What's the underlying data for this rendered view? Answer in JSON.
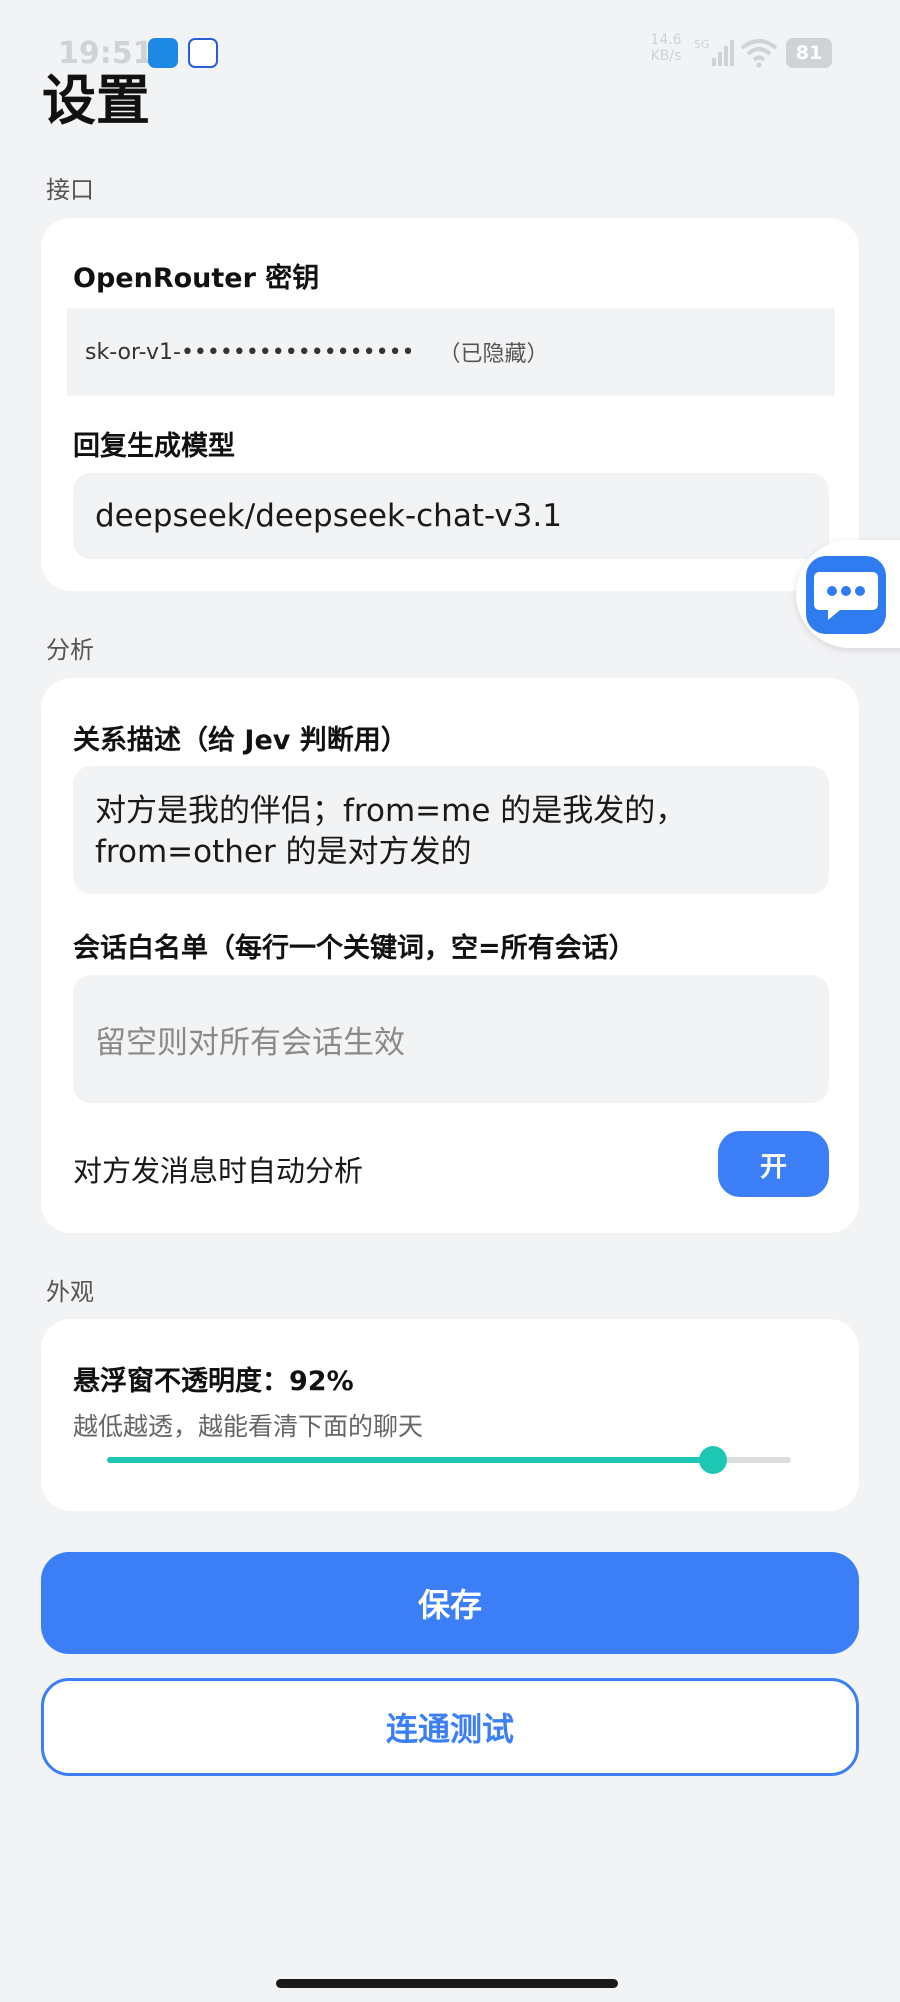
{
  "status_bar": {
    "time": "19:51",
    "net_speed": "14.6",
    "net_unit": "KB/s",
    "net_type": "5G",
    "battery": "81"
  },
  "page": {
    "title": "设置"
  },
  "interface_section": {
    "label": "接口",
    "key_label": "OpenRouter 密钥",
    "key_value": "sk-or-v1-••••••••••••••••••",
    "key_hidden_note": "（已隐藏）",
    "model_label": "回复生成模型",
    "model_value": "deepseek/deepseek-chat-v3.1"
  },
  "analysis_section": {
    "label": "分析",
    "relation_label": "关系描述（给 Jev 判断用）",
    "relation_value": "对方是我的伴侣；from=me 的是我发的，from=other 的是对方发的",
    "whitelist_label": "会话白名单（每行一个关键词，空=所有会话）",
    "whitelist_value": "",
    "whitelist_placeholder": "留空则对所有会话生效",
    "auto_label": "对方发消息时自动分析",
    "auto_toggle_text": "开"
  },
  "appearance_section": {
    "label": "外观",
    "opacity_label": "悬浮窗不透明度：92%",
    "opacity_hint": "越低越透，越能看清下面的聊天",
    "opacity_value": 0.92
  },
  "actions": {
    "save_label": "保存",
    "test_label": "连通测试"
  },
  "icons": {
    "float_bubble": "chat-bubble-icon"
  },
  "colors": {
    "accent": "#3b7ef5",
    "slider": "#1ec7b4"
  }
}
